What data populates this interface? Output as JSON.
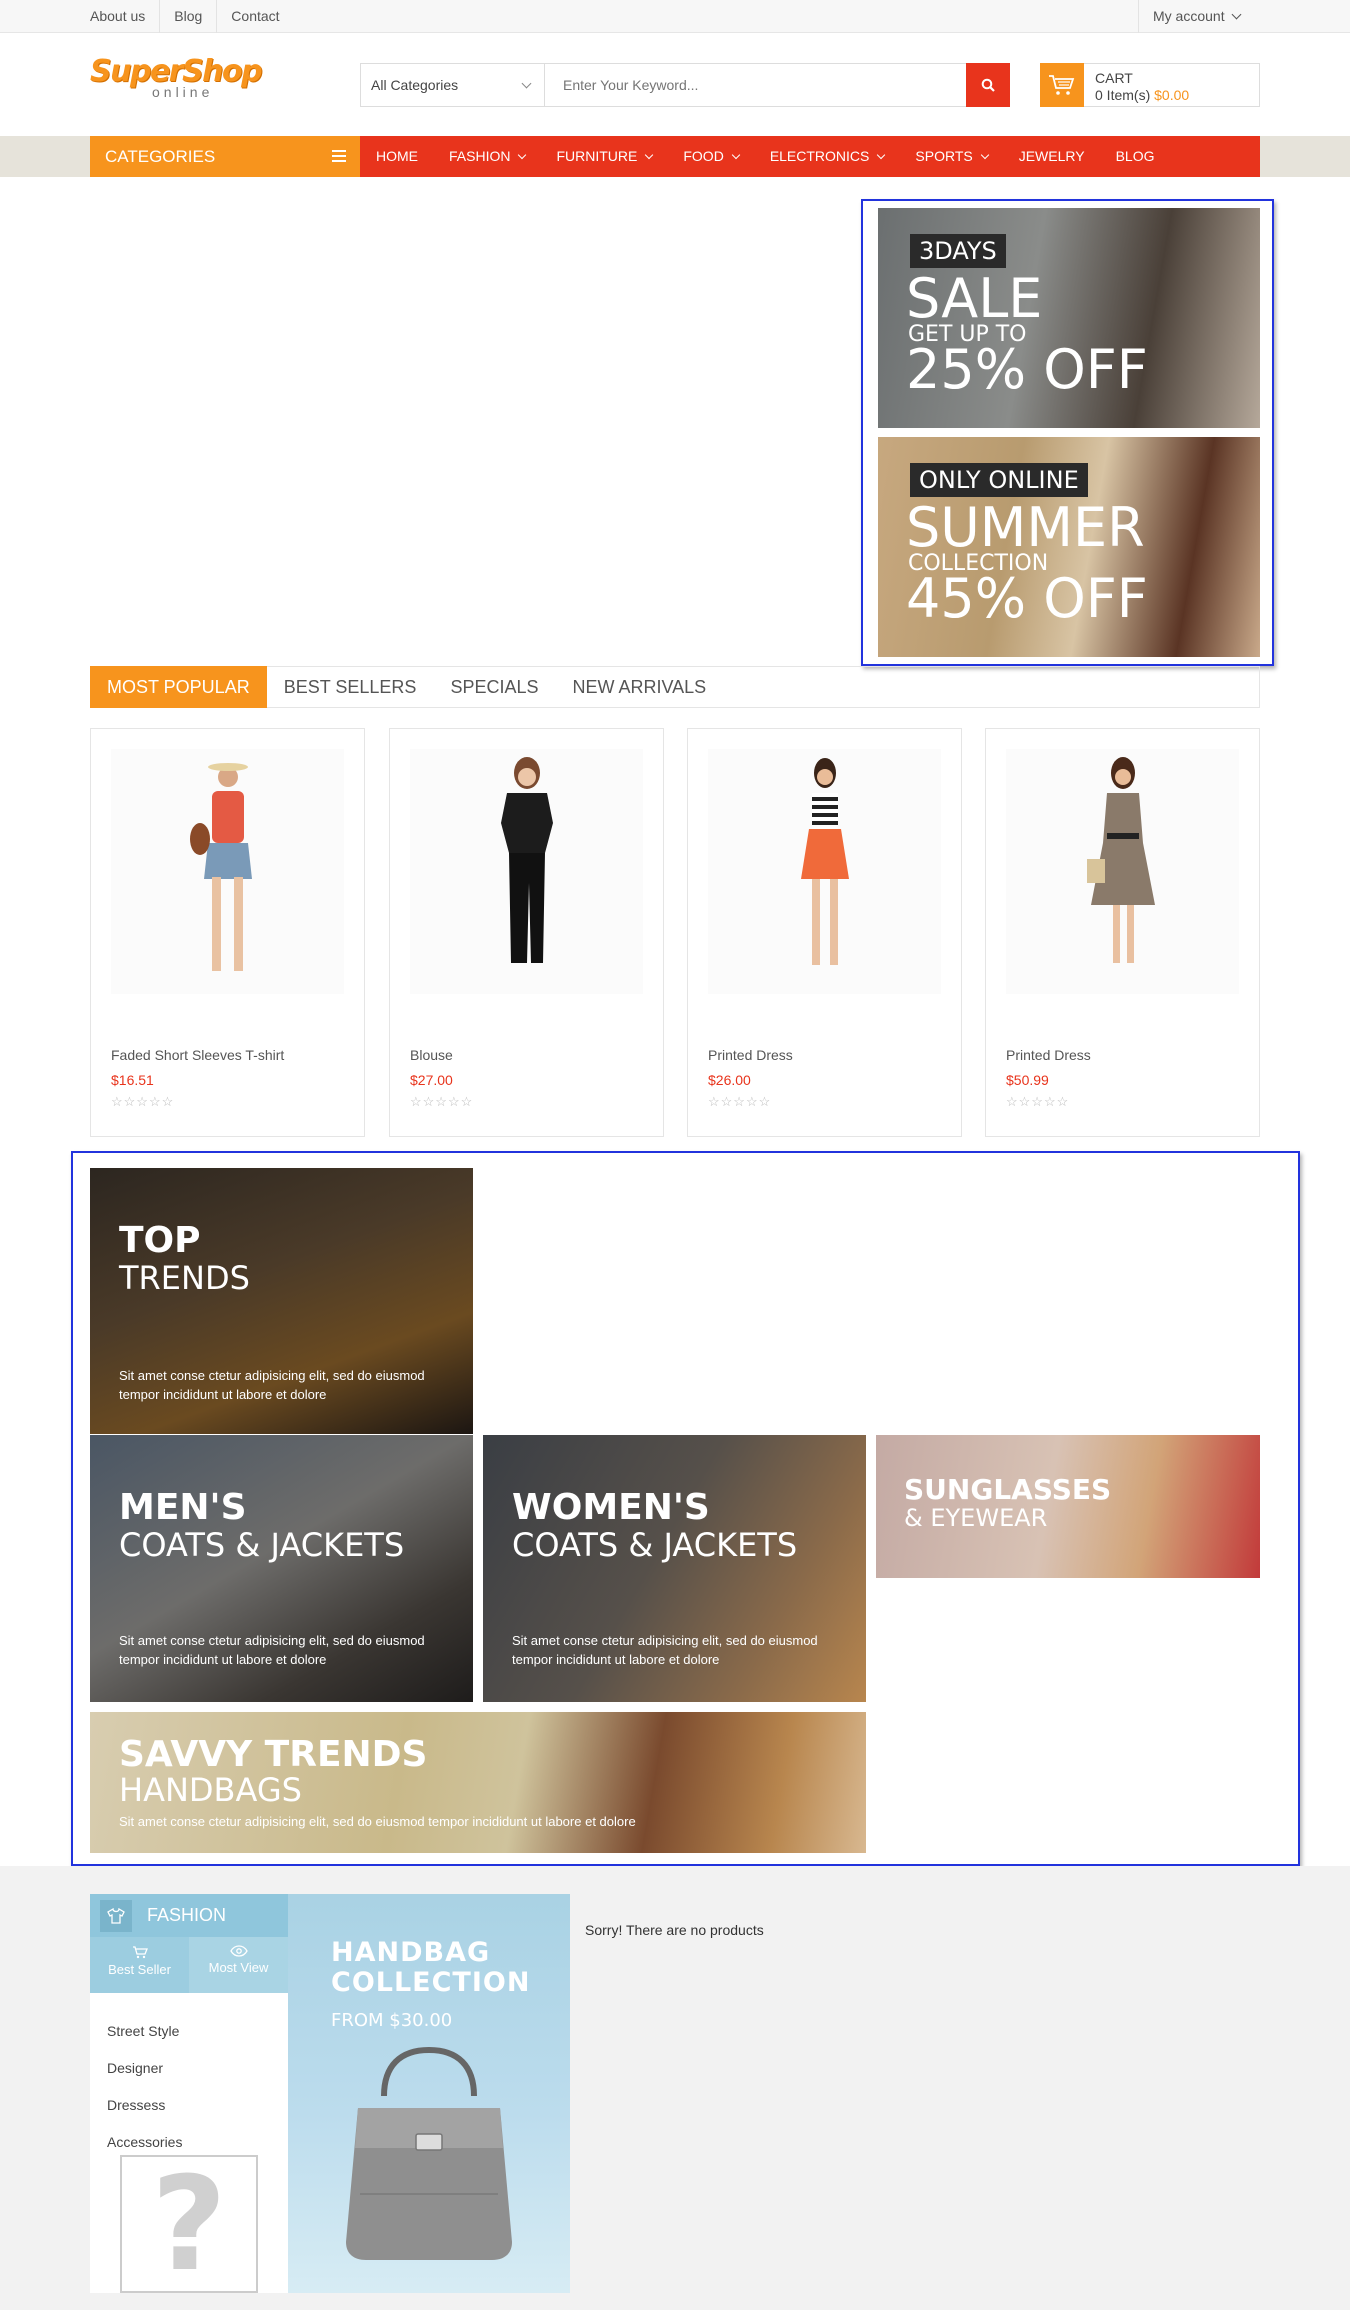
{
  "topbar": {
    "links": [
      "About us",
      "Blog",
      "Contact"
    ],
    "account": "My account"
  },
  "header": {
    "logo_main": "SuperShop",
    "logo_sub": "online",
    "search_category": "All Categories",
    "search_placeholder": "Enter Your Keyword...",
    "cart_label": "CART",
    "cart_items": "0 Item(s)",
    "cart_amount": "$0.00"
  },
  "nav": {
    "categories_label": "CATEGORIES",
    "items": [
      {
        "label": "HOME",
        "dropdown": false
      },
      {
        "label": "FASHION",
        "dropdown": true
      },
      {
        "label": "FURNITURE",
        "dropdown": true
      },
      {
        "label": "FOOD",
        "dropdown": true
      },
      {
        "label": "ELECTRONICS",
        "dropdown": true
      },
      {
        "label": "SPORTS",
        "dropdown": true
      },
      {
        "label": "JEWELRY",
        "dropdown": false
      },
      {
        "label": "BLOG",
        "dropdown": false
      }
    ]
  },
  "promos": [
    {
      "tag": "3DAYS",
      "big": "SALE",
      "sub": "GET UP TO",
      "pct": "25% OFF"
    },
    {
      "tag": "ONLY ONLINE",
      "big": "SUMMER",
      "sub": "COLLECTION",
      "pct": "45% OFF"
    }
  ],
  "tabs": [
    "MOST POPULAR",
    "BEST SELLERS",
    "SPECIALS",
    "NEW ARRIVALS"
  ],
  "products": [
    {
      "name": "Faded Short Sleeves T-shirt",
      "price": "$16.51",
      "stars": "☆☆☆☆☆"
    },
    {
      "name": "Blouse",
      "price": "$27.00",
      "stars": "☆☆☆☆☆"
    },
    {
      "name": "Printed Dress",
      "price": "$26.00",
      "stars": "☆☆☆☆☆"
    },
    {
      "name": "Printed Dress",
      "price": "$50.99",
      "stars": "☆☆☆☆☆"
    }
  ],
  "lookbook": {
    "desc": "Sit amet conse ctetur adipisicing elit, sed do eiusmod tempor incididunt ut labore et dolore",
    "top": {
      "t1": "TOP",
      "t2": "TRENDS"
    },
    "men": {
      "t1": "MEN'S",
      "t2": "COATS & JACKETS"
    },
    "women": {
      "t1": "WOMEN'S",
      "t2": "COATS & JACKETS"
    },
    "sunglasses": {
      "t1": "SUNGLASSES",
      "t2": "& EYEWEAR"
    },
    "savvy": {
      "t1": "SAVVY TRENDS",
      "t2": "HANDBAGS",
      "desc": "Sit amet conse ctetur adipisicing elit, sed do eiusmod tempor incididunt ut labore et dolore"
    }
  },
  "fashion": {
    "title": "FASHION",
    "tab_best": "Best Seller",
    "tab_most": "Most View",
    "list": [
      "Street Style",
      "Designer",
      "Dressess",
      "Accessories"
    ],
    "placeholder": "?",
    "banner_title": "HANDBAG COLLECTION",
    "banner_sub": "FROM $30.00",
    "no_products": "Sorry! There are no products"
  },
  "colors": {
    "accent_orange": "#f7941d",
    "accent_red": "#e8341c",
    "fashion_blue": "#8fc6dc"
  }
}
